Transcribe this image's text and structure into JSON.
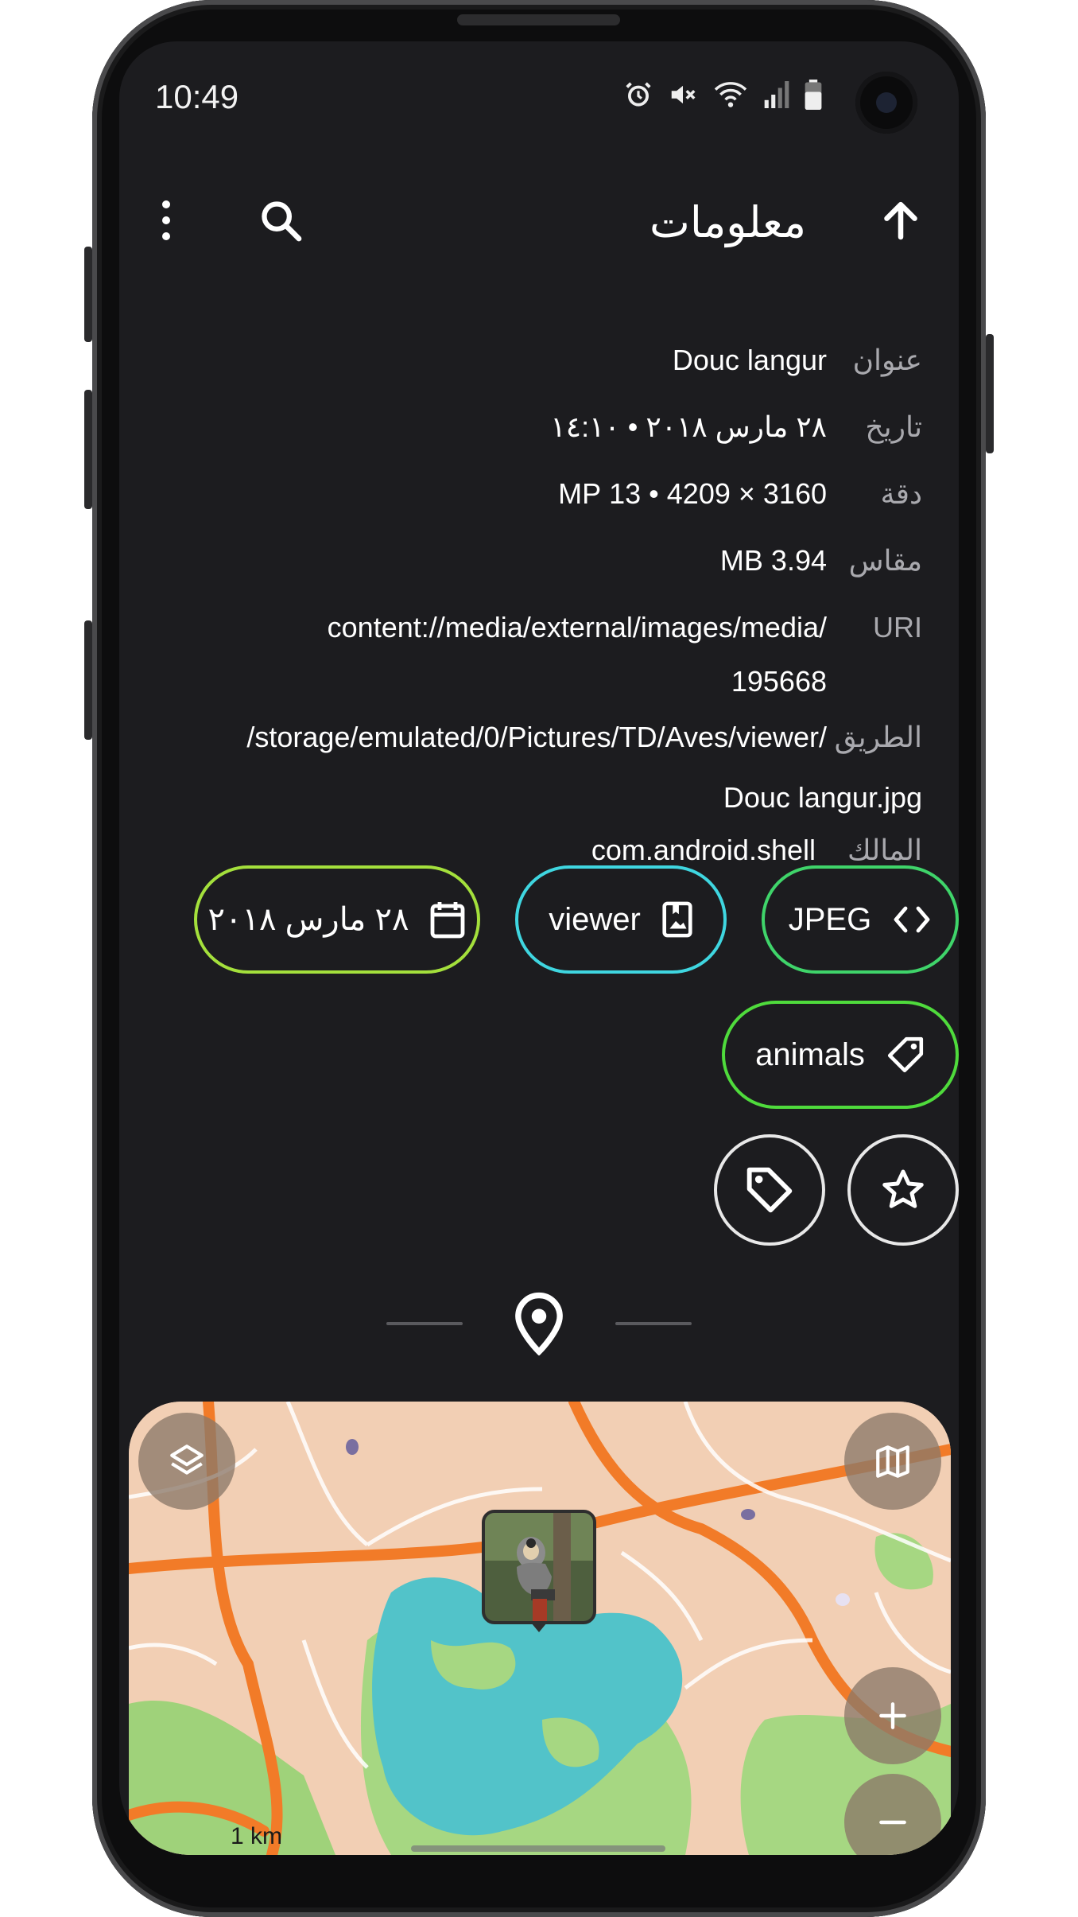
{
  "status_bar": {
    "time": "10:49"
  },
  "app_bar": {
    "title": "معلومات"
  },
  "info": {
    "title_label": "عنوان",
    "title_value": "Douc langur",
    "date_label": "تاريخ",
    "date_value": "٢٨ مارس ٢٠١٨ • ١٤:١٠",
    "resolution_label": "دقة",
    "resolution_value": "3160 × 4209 • 13 MP",
    "size_label": "مقاس",
    "size_value": "3.94 MB",
    "uri_label": "URI",
    "uri_value_line1": "content://media/external/images/media/",
    "uri_value_line2": "195668",
    "path_label": "الطريق",
    "path_value_line1": "/storage/emulated/0/Pictures/TD/Aves/viewer/",
    "path_value_line2": "Douc langur.jpg",
    "owner_label": "المالك",
    "owner_value": "com.android.shell"
  },
  "chips": {
    "format": "JPEG",
    "album": "viewer",
    "date": "٢٨ مارس ٢٠١٨",
    "tag": "animals"
  },
  "chip_colors": {
    "format": "#3fd46a",
    "album": "#3fd6e0",
    "date": "#a4e03c",
    "tag": "#4fdb3c"
  },
  "map": {
    "scale": "1 km"
  },
  "icons": {
    "back": "arrow-up-icon",
    "search": "search-icon",
    "menu": "more-vert-icon",
    "format": "code-icon",
    "album": "photo-album-icon",
    "date": "calendar-icon",
    "tag": "tag-icon",
    "edit_tags": "tag-icon",
    "favorite": "star-icon",
    "location": "location-pin-icon",
    "layers": "layers-icon",
    "map_style": "map-icon",
    "zoom_in": "plus-icon",
    "zoom_out": "minus-icon"
  }
}
